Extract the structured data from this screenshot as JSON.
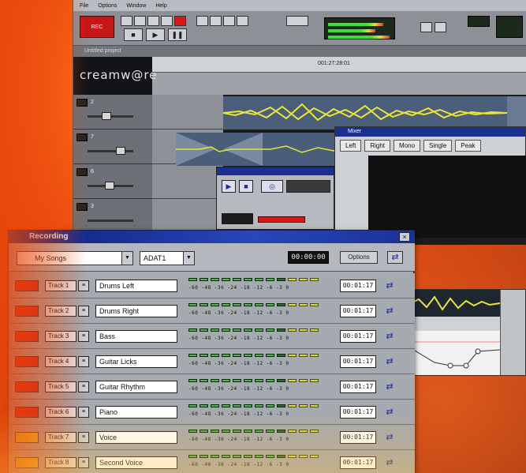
{
  "menu": {
    "items": [
      "File",
      "Options",
      "Window",
      "Help"
    ]
  },
  "daw": {
    "brand": "creamw@re",
    "project_title": "Untitled project",
    "ruler_time": "001:27:28:01",
    "track_numbers": [
      "2",
      "7",
      "6",
      "3"
    ],
    "sub_window": {
      "title": "Mixer",
      "tabs": [
        "Left",
        "Right",
        "Mono",
        "Single",
        "Peak"
      ]
    }
  },
  "recording": {
    "title": "Recording",
    "folder_select": "My Songs",
    "device_select": "ADAT1",
    "counter": "00:00:00",
    "options_label": "Options",
    "close_label": "×",
    "db_scale": "-60 -48 -36 -24 -18 -12 -6  -3   0",
    "tracks": [
      {
        "name": "Track 1",
        "label": "Drums Left",
        "time": "00:01:17",
        "armed_color": "#d81e1e"
      },
      {
        "name": "Track 2",
        "label": "Drums Right",
        "time": "00:01:17",
        "armed_color": "#d81e1e"
      },
      {
        "name": "Track 3",
        "label": "Bass",
        "time": "00:01:17",
        "armed_color": "#d81e1e"
      },
      {
        "name": "Track 4",
        "label": "Guitar Licks",
        "time": "00:01:17",
        "armed_color": "#d81e1e"
      },
      {
        "name": "Track 5",
        "label": "Guitar Rhythm",
        "time": "00:01:17",
        "armed_color": "#d81e1e"
      },
      {
        "name": "Track 6",
        "label": "Piano",
        "time": "00:01:17",
        "armed_color": "#d81e1e"
      },
      {
        "name": "Track 7",
        "label": "Voice",
        "time": "00:01:17",
        "armed_color": "#e8c818"
      },
      {
        "name": "Track 8",
        "label": "Second Voice",
        "time": "00:01:17",
        "armed_color": "#e8c818"
      }
    ]
  },
  "icons": {
    "close": "close-icon",
    "folder": "folder-icon",
    "dropdown": "chevron-down-icon",
    "track_link": "link-icon",
    "play": "play-icon",
    "stop": "stop-icon"
  },
  "colors": {
    "accent": "#1b2f8f",
    "waveform": "#e8e43a",
    "armed": "#d81e1e",
    "background": "#e8480c"
  }
}
